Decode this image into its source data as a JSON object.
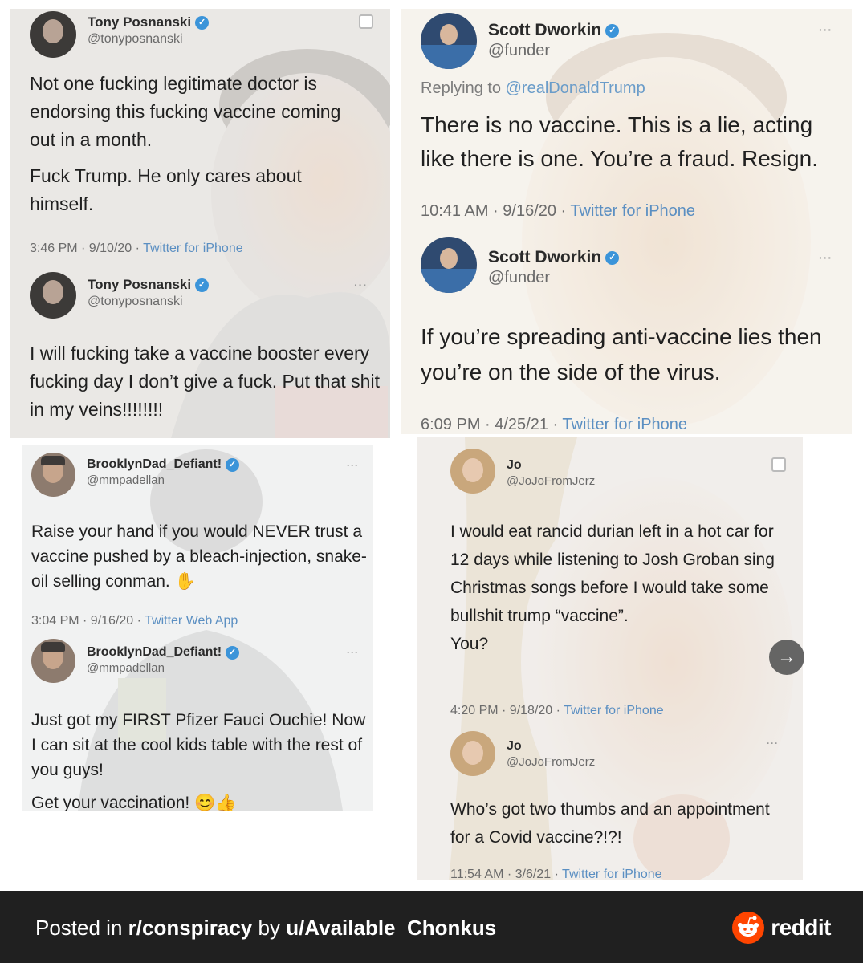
{
  "panels": {
    "top_left": {
      "tweets": [
        {
          "name": "Tony Posnanski",
          "handle": "@tonyposnanski",
          "body": [
            "Not one fucking legitimate doctor is endorsing this fucking vaccine coming out in a month.",
            "Fuck Trump. He only cares about himself."
          ],
          "time": "3:46 PM · 9/10/20 · ",
          "source": "Twitter for iPhone"
        },
        {
          "name": "Tony Posnanski",
          "handle": "@tonyposnanski",
          "body": [
            "I will fucking take a vaccine booster every fucking day I don’t give a fuck. Put that shit in my veins!!!!!!!!"
          ]
        }
      ]
    },
    "top_right": {
      "tweets": [
        {
          "name": "Scott Dworkin",
          "handle": "@funder",
          "replying_label": "Replying to ",
          "replying_to": "@realDonaldTrump",
          "body": [
            "There is no vaccine. This is a lie, acting like there is one. You’re a fraud. Resign."
          ],
          "time": "10:41 AM · 9/16/20 · ",
          "source": "Twitter for iPhone"
        },
        {
          "name": "Scott Dworkin",
          "handle": "@funder",
          "body": [
            "If you’re spreading anti-vaccine lies then you’re on the side of the virus."
          ],
          "time": "6:09 PM · 4/25/21 · ",
          "source": "Twitter for iPhone"
        }
      ]
    },
    "bottom_left": {
      "tweets": [
        {
          "name": "BrooklynDad_Defiant!",
          "handle": "@mmpadellan",
          "body": [
            "Raise your hand if you would NEVER trust a vaccine pushed by a bleach-injection, snake-oil selling conman. "
          ],
          "emoji": "✋",
          "time": "3:04 PM · 9/16/20 · ",
          "source": "Twitter Web App"
        },
        {
          "name": "BrooklynDad_Defiant!",
          "handle": "@mmpadellan",
          "body": [
            "Just got my FIRST Pfizer Fauci Ouchie! Now I can sit at the cool kids table with the rest of you guys!"
          ],
          "body2": "Get your vaccination! ",
          "emoji": "😊👍"
        }
      ]
    },
    "bottom_right": {
      "tweets": [
        {
          "name": "Jo",
          "handle": "@JoJoFromJerz",
          "body": [
            "I would eat rancid durian left in a hot car for 12 days while listening to Josh Groban sing Christmas songs before I would take some bullshit trump “vaccine”.",
            "You?"
          ],
          "time": "4:20 PM · 9/18/20 · ",
          "source": "Twitter for iPhone"
        },
        {
          "name": "Jo",
          "handle": "@JoJoFromJerz",
          "body": [
            "Who’s got two thumbs and an appointment for a Covid vaccine?!?!"
          ],
          "time": "11:54 AM · 3/6/21 · ",
          "source": "Twitter for iPhone"
        }
      ]
    }
  },
  "icons": {
    "more": "···",
    "verified": "✓",
    "next": "→"
  },
  "footer": {
    "posted_in": "Posted in ",
    "subreddit": "r/conspiracy",
    "by": " by ",
    "user": "u/Available_Chonkus",
    "brand": "reddit"
  },
  "colors": {
    "footer_bg": "#202020",
    "verified": "#3b94d9",
    "reddit_orange": "#ff4500"
  }
}
